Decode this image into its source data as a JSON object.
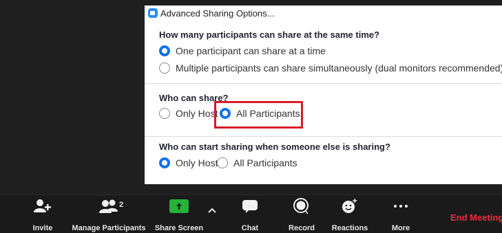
{
  "dialog": {
    "title": "Advanced Sharing Options...",
    "sections": [
      {
        "heading": "How many participants can share at the same time?",
        "options": [
          {
            "label": "One participant can share at a time",
            "selected": true
          },
          {
            "label": "Multiple participants can share simultaneously (dual monitors recommended)",
            "selected": false
          }
        ]
      },
      {
        "heading": "Who can share?",
        "options": [
          {
            "label": "Only Host",
            "selected": false
          },
          {
            "label": "All Participants",
            "selected": true
          }
        ]
      },
      {
        "heading": "Who can start sharing when someone else is sharing?",
        "options": [
          {
            "label": "Only Host",
            "selected": true
          },
          {
            "label": "All Participants",
            "selected": false
          }
        ]
      }
    ]
  },
  "colors": {
    "accent": "#0e71eb",
    "highlight": "#d9182a",
    "share_green": "#24b33a",
    "end_red": "#ee2d3f"
  },
  "toolbar": {
    "invite": {
      "label": "Invite",
      "icon": "add-user-icon"
    },
    "manage_participants": {
      "label": "Manage Participants",
      "count": "2",
      "icon": "participants-icon"
    },
    "share_screen": {
      "label": "Share Screen",
      "icon": "share-screen-icon"
    },
    "chat": {
      "label": "Chat",
      "icon": "chat-icon"
    },
    "record": {
      "label": "Record",
      "icon": "record-icon"
    },
    "reactions": {
      "label": "Reactions",
      "icon": "reactions-icon"
    },
    "more": {
      "label": "More",
      "icon": "more-icon"
    },
    "end_meeting": "End Meeting"
  }
}
